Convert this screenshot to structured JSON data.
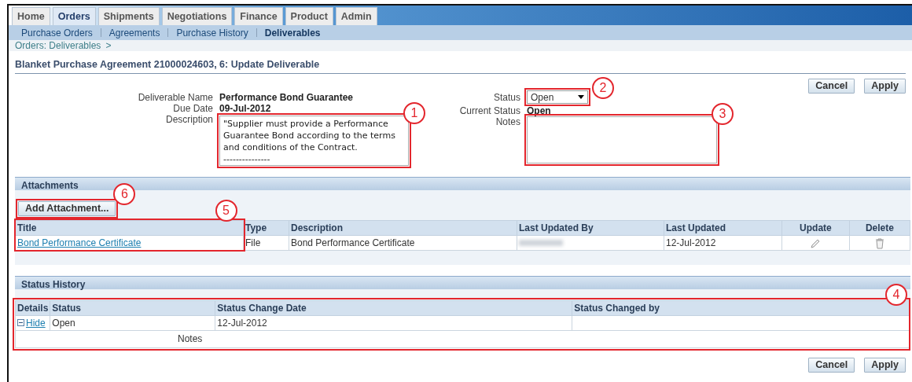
{
  "tabs": [
    {
      "label": "Home",
      "selected": false
    },
    {
      "label": "Orders",
      "selected": true
    },
    {
      "label": "Shipments",
      "selected": false
    },
    {
      "label": "Negotiations",
      "selected": false
    },
    {
      "label": "Finance",
      "selected": false
    },
    {
      "label": "Product",
      "selected": false
    },
    {
      "label": "Admin",
      "selected": false
    }
  ],
  "subtabs": [
    {
      "label": "Purchase Orders",
      "selected": false
    },
    {
      "label": "Agreements",
      "selected": false
    },
    {
      "label": "Purchase History",
      "selected": false
    },
    {
      "label": "Deliverables",
      "selected": true
    }
  ],
  "breadcrumb": {
    "link": "Orders: Deliverables",
    "separator": ">"
  },
  "page_title": "Blanket Purchase Agreement 21000024603, 6: Update Deliverable",
  "top_buttons": [
    "Cancel",
    "Apply"
  ],
  "info_fields": [
    {
      "label": "Deliverable Name",
      "value": "Performance Bond Guarantee"
    },
    {
      "label": "Due Date",
      "value": "09-Jul-2012"
    }
  ],
  "description": {
    "label": "Description",
    "value": "\"Supplier must provide a Performance Guarantee Bond according to the terms and conditions of the Contract.\n---------------"
  },
  "status": {
    "label": "Status",
    "value": "Open"
  },
  "current_status": {
    "label": "Current Status",
    "value": "Open"
  },
  "notes": {
    "label": "Notes"
  },
  "attachments": {
    "title": "Attachments",
    "add_button": "Add Attachment...",
    "columns": [
      "Title",
      "Type",
      "Description",
      "Last Updated By",
      "Last Updated",
      "Update",
      "Delete"
    ],
    "rows": [
      {
        "title": "Bond Performance Certificate",
        "type": "File",
        "description": "Bond Performance Certificate",
        "last_updated": "12-Jul-2012"
      }
    ]
  },
  "status_history": {
    "title": "Status History",
    "columns": [
      "Details",
      "Status",
      "Status Change Date",
      "Status Changed by"
    ],
    "rows": [
      {
        "details_link": "Hide",
        "expanded": true,
        "status": "Open",
        "date": "12-Jul-2012",
        "notes_label": "Notes"
      }
    ]
  },
  "bottom_buttons": [
    "Cancel",
    "Apply"
  ],
  "callouts": [
    {
      "number": "1"
    },
    {
      "number": "2"
    },
    {
      "number": "3"
    },
    {
      "number": "4"
    },
    {
      "number": "5"
    },
    {
      "number": "6"
    }
  ]
}
